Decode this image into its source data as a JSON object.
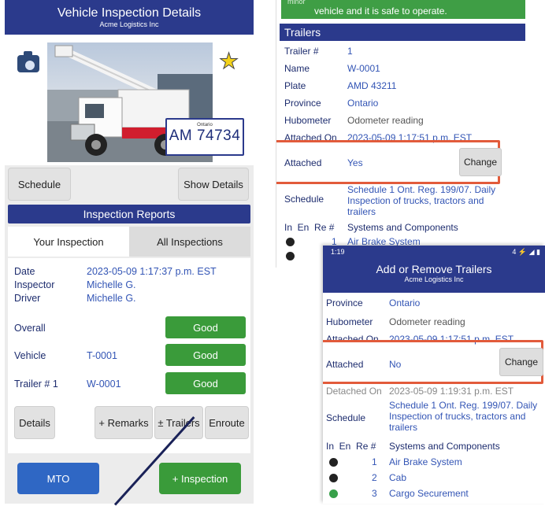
{
  "left": {
    "header": {
      "title": "Vehicle Inspection Details",
      "subtitle": "Acme Logistics Inc"
    },
    "plate": {
      "province": "Ontario",
      "number": "AM 74734"
    },
    "buttons": {
      "schedule": "Schedule",
      "show_details": "Show Details"
    },
    "reports_title": "Inspection Reports",
    "tabs": [
      "Your Inspection",
      "All Inspections"
    ],
    "report": {
      "date_label": "Date",
      "date": "2023-05-09 1:17:37 p.m. EST",
      "inspector_label": "Inspector",
      "inspector": "Michelle G.",
      "driver_label": "Driver",
      "driver": "Michelle G.",
      "overall_label": "Overall",
      "overall": "Good",
      "vehicle_label": "Vehicle",
      "vehicle": "T-0001",
      "vehicle_status": "Good",
      "trailer_label": "Trailer # 1",
      "trailer": "W-0001",
      "trailer_status": "Good"
    },
    "actions": {
      "details": "Details",
      "remarks": "+ Remarks",
      "trailers": "± Trailers",
      "enroute": "Enroute"
    },
    "bottom": {
      "mto": "MTO",
      "inspection": "+ Inspection"
    }
  },
  "right_top": {
    "banner_line1": "minor",
    "banner_line2": "vehicle and it is safe to operate.",
    "section": "Trailers",
    "fields": {
      "trailer_num_label": "Trailer #",
      "trailer_num": "1",
      "name_label": "Name",
      "name": "W-0001",
      "plate_label": "Plate",
      "plate": "AMD 43211",
      "province_label": "Province",
      "province": "Ontario",
      "hub_label": "Hubometer",
      "hub": "Odometer reading",
      "attached_on_label": "Attached On",
      "attached_on": "2023-05-09 1:17:51 p.m. EST",
      "attached_label": "Attached",
      "attached": "Yes",
      "schedule_label": "Schedule",
      "schedule": "Schedule 1 Ont. Reg. 199/07. Daily Inspection of trucks, tractors and trailers"
    },
    "change": "Change",
    "cols": "In  En  Re #",
    "systems": "Systems and Components",
    "item1_num": "1",
    "item1": "Air Brake System"
  },
  "right_bottom": {
    "status_time": "1:19",
    "status_right": "4 ⚡ ◢ ▮",
    "header": {
      "title": "Add or Remove Trailers",
      "subtitle": "Acme Logistics Inc"
    },
    "fields": {
      "province_label": "Province",
      "province": "Ontario",
      "hub_label": "Hubometer",
      "hub": "Odometer reading",
      "attached_on_label": "Attached On",
      "attached_on": "2023-05-09 1:17:51 p.m. EST",
      "attached_label": "Attached",
      "attached": "No",
      "detached_label": "Detached On",
      "detached_on": "2023-05-09 1:19:31 p.m. EST",
      "schedule_label": "Schedule",
      "schedule": "Schedule 1 Ont. Reg. 199/07. Daily Inspection of trucks, tractors and trailers"
    },
    "change": "Change",
    "cols": "In  En  Re #",
    "systems": "Systems and Components",
    "items": [
      {
        "num": "1",
        "label": "Air Brake System",
        "status": "na"
      },
      {
        "num": "2",
        "label": "Cab",
        "status": "na"
      },
      {
        "num": "3",
        "label": "Cargo Securement",
        "status": "ok"
      }
    ]
  }
}
